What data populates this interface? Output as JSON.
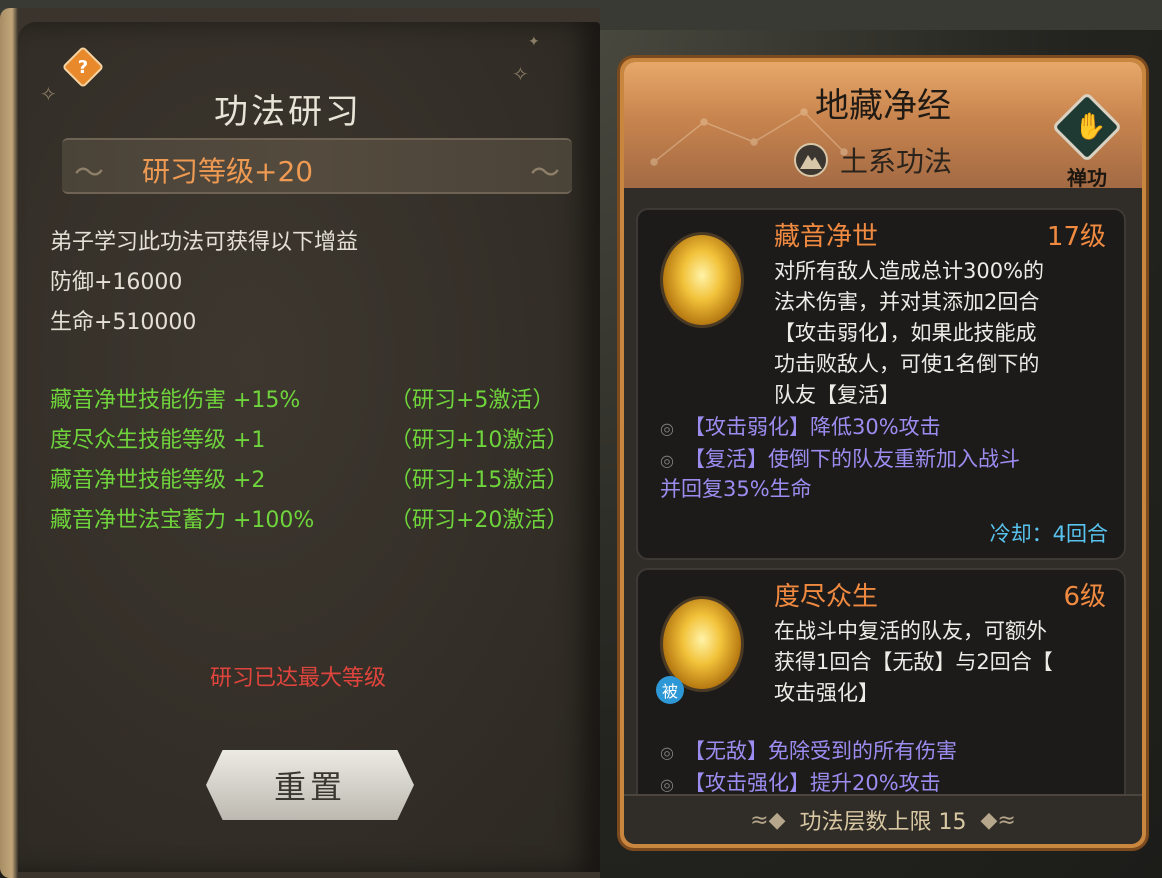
{
  "left_panel": {
    "title": "功法研习",
    "level_label": "研习等级+20",
    "intro": "弟子学习此功法可获得以下增益",
    "stats": [
      "防御+16000",
      "生命+510000"
    ],
    "bonuses": [
      {
        "effect": "藏音净世技能伤害 +15%",
        "requirement": "（研习+5激活）"
      },
      {
        "effect": "度尽众生技能等级 +1",
        "requirement": "（研习+10激活）"
      },
      {
        "effect": "藏音净世技能等级 +2",
        "requirement": "（研习+15激活）"
      },
      {
        "effect": "藏音净世法宝蓄力 +100%",
        "requirement": "（研习+20激活）"
      }
    ],
    "max_level_message": "研习已达最大等级",
    "reset_label": "重置",
    "help_icon": "?"
  },
  "right_panel": {
    "title": "地藏净经",
    "element_label": "土系功法",
    "type_badge": "禅功",
    "skills": [
      {
        "name": "藏音净世",
        "level": "17级",
        "desc_lines": [
          "对所有敌人造成总计300%的",
          "法术伤害，并对其添加2回合",
          "【攻击弱化】，如果此技能成",
          "功击败敌人，可使1名倒下的",
          "队友【复活】"
        ],
        "effects": [
          "【攻击弱化】降低30%攻击",
          "【复活】使倒下的队友重新加入战斗",
          "并回复35%生命"
        ],
        "cooldown": "冷却：4回合"
      },
      {
        "name": "度尽众生",
        "level": "6级",
        "passive_tag": "被",
        "desc_lines": [
          "在战斗中复活的队友，可额外",
          "获得1回合【无敌】与2回合【",
          "攻击强化】"
        ],
        "effects": [
          "【无敌】免除受到的所有伤害",
          "【攻击强化】提升20%攻击"
        ]
      }
    ],
    "footer": "功法层数上限 15"
  },
  "colors": {
    "accent_orange": "#f08a40",
    "bonus_green": "#6fd43c",
    "warning_red": "#e0453d",
    "effect_purple": "#9b8cf0",
    "cooldown_blue": "#57c3ee"
  }
}
